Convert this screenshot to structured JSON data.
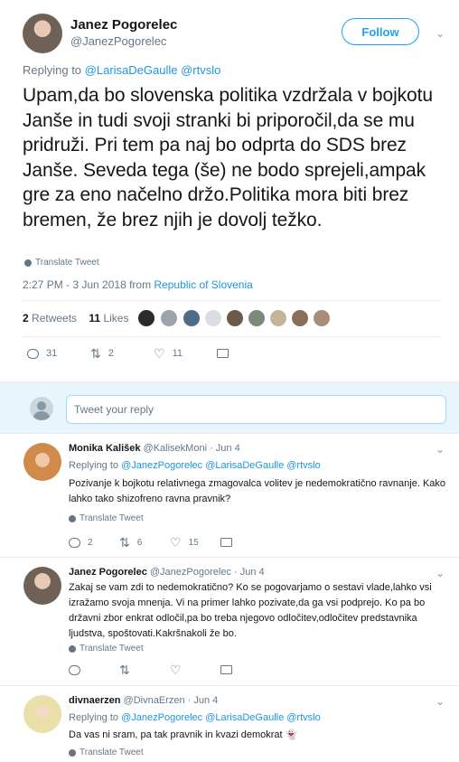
{
  "tweet": {
    "author_name": "Janez Pogorelec",
    "author_handle": "@JanezPogorelec",
    "follow_label": "Follow",
    "replying_to_prefix": "Replying to",
    "replying_to": [
      "@LarisaDeGaulle",
      "@rtvslo"
    ],
    "text": "Upam,da bo slovenska politika vzdržala v bojkotu Janše in tudi svoji stranki bi priporočil,da se mu pridruži. Pri tem pa naj bo odprta do SDS brez Janše. Seveda tega (še) ne bodo sprejeli,ampak gre za eno  načelno držo.Politika mora biti brez bremen, že brez njih je dovolj težko.",
    "translate_label": "Translate Tweet",
    "timestamp": "2:27 PM - 3 Jun 2018 from",
    "location": "Republic of Slovenia",
    "retweets_count": "2",
    "retweets_label": "Retweets",
    "likes_count": "11",
    "likes_label": "Likes",
    "actions": {
      "replies": "31",
      "retweets": "2",
      "likes": "11"
    }
  },
  "reply_box": {
    "placeholder": "Tweet your reply"
  },
  "replies": [
    {
      "name": "Monika Kališek",
      "handle": "@KalisekMoni",
      "date": "· Jun 4",
      "replying_prefix": "Replying to",
      "replying_to": "@JanezPogorelec @LarisaDeGaulle @rtvslo",
      "text": "Pozivanje k bojkotu relativnega zmagovalca volitev je nedemokratično ravnanje. Kako lahko tako shizofreno ravna pravnik?",
      "translate_label": "Translate Tweet",
      "actions": {
        "replies": "2",
        "retweets": "6",
        "likes": "15"
      }
    },
    {
      "name": "Janez Pogorelec",
      "handle": "@JanezPogorelec",
      "date": "· Jun 4",
      "text": "Zakaj se vam zdi to nedemokratično? Ko se pogovarjamo o sestavi vlade,lahko vsi izražamo svoja mnenja. Vi na primer lahko pozivate,da ga vsi podprejo. Ko pa bo državni zbor enkrat odločil,pa bo treba njegovo odločitev,odločitev predstavnika ljudstva, spoštovati.Kakršnakoli že bo.",
      "translate_label": "Translate Tweet",
      "actions": {
        "replies": "",
        "retweets": "",
        "likes": ""
      }
    },
    {
      "name": "divnaerzen",
      "handle": "@DivnaErzen",
      "date": "· Jun 4",
      "replying_prefix": "Replying to",
      "replying_to": "@JanezPogorelec @LarisaDeGaulle @rtvslo",
      "text": "Da vas ni sram, pa tak pravnik in kvazi demokrat",
      "translate_label": "Translate Tweet"
    }
  ],
  "colors": {
    "accent": "#1da1f2",
    "link": "#1b95e0",
    "muted": "#657786",
    "reply_box_bg": "#e8f5fd"
  }
}
